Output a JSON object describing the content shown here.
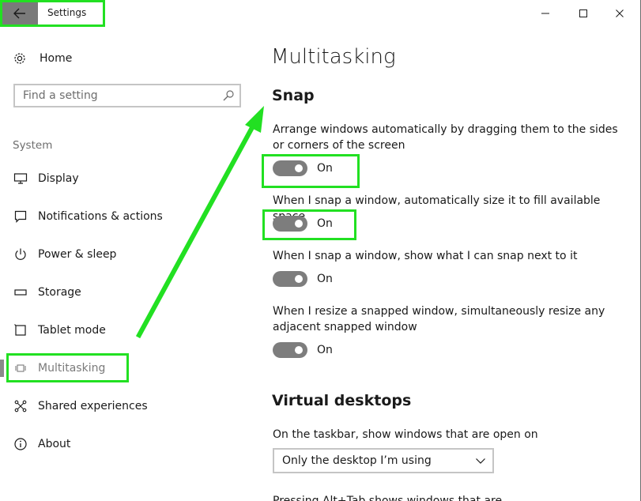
{
  "window": {
    "title": "Settings"
  },
  "sidebar": {
    "home_label": "Home",
    "search_placeholder": "Find a setting",
    "group_label": "System",
    "items": [
      {
        "label": "Display",
        "icon": "display-icon"
      },
      {
        "label": "Notifications & actions",
        "icon": "notifications-icon"
      },
      {
        "label": "Power & sleep",
        "icon": "power-icon"
      },
      {
        "label": "Storage",
        "icon": "storage-icon"
      },
      {
        "label": "Tablet mode",
        "icon": "tablet-icon"
      },
      {
        "label": "Multitasking",
        "icon": "multitasking-icon",
        "active": true
      },
      {
        "label": "Shared experiences",
        "icon": "shared-experiences-icon"
      },
      {
        "label": "About",
        "icon": "info-icon"
      }
    ]
  },
  "main": {
    "page_title": "Multitasking",
    "snap": {
      "title": "Snap",
      "settings": [
        {
          "desc": "Arrange windows automatically by dragging them to the sides or corners of the screen",
          "state": "On"
        },
        {
          "desc": "When I snap a window, automatically size it to fill available space",
          "state": "On"
        },
        {
          "desc": "When I snap a window, show what I can snap next to it",
          "state": "On"
        },
        {
          "desc": "When I resize a snapped window, simultaneously resize any adjacent snapped window",
          "state": "On"
        }
      ]
    },
    "virtual_desktops": {
      "title": "Virtual desktops",
      "taskbar_label": "On the taskbar, show windows that are open on",
      "taskbar_value": "Only the desktop I’m using",
      "next_label_partial": "Pressing Alt+Tab shows windows that are"
    }
  },
  "colors": {
    "highlight": "#22e022",
    "toggle_on": "#7d7d7d",
    "back_button": "#7a7a7a"
  }
}
